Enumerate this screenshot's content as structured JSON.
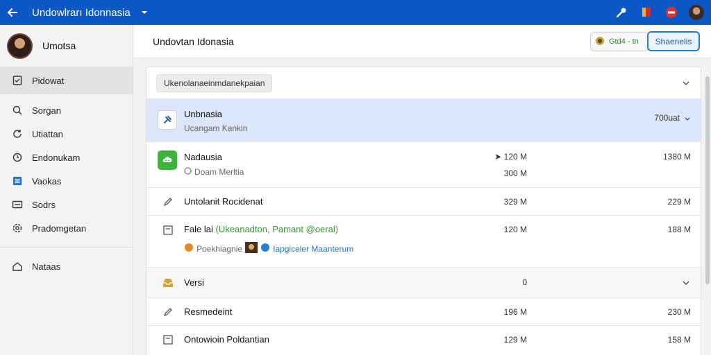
{
  "topbar": {
    "title": "Undowlrarı Idonnasia"
  },
  "sidebar": {
    "user_name": "Umotsa",
    "items": [
      {
        "label": "Pidowat",
        "icon": "document-check-icon"
      },
      {
        "label": "Sorgan",
        "icon": "search-icon"
      },
      {
        "label": "Utiattan",
        "icon": "refresh-icon"
      },
      {
        "label": "Endonukam",
        "icon": "clock-icon"
      },
      {
        "label": "Vaokas",
        "icon": "list-icon"
      },
      {
        "label": "Sodrs",
        "icon": "card-icon"
      },
      {
        "label": "Pradomgetan",
        "icon": "gear-icon"
      },
      {
        "label": "Nataas",
        "icon": "home-icon"
      }
    ]
  },
  "main": {
    "title": "Undovtan Idonasia",
    "pill_text": "Gtd4 - tn",
    "button_label": "Shaenelis"
  },
  "panel": {
    "filter_chip": "Ukenolanaeinmdanekpaian",
    "rows": [
      {
        "title": "Unbnasia",
        "subtitle": "Ucangam Kankin",
        "col2": "700uat"
      },
      {
        "title": "Nadausia",
        "subtitle": "Doam Merltia",
        "col1_top": "120 M",
        "col1_bottom": "300 M",
        "col2": "1380 M"
      },
      {
        "title": "Untolanit Rocidenat",
        "col1": "329 M",
        "col2": "229 M"
      },
      {
        "title_prefix": "Fale lai",
        "title_link": "(Ukeanadton, Pamant @oeral)",
        "sub_a": "Poekhiagnie",
        "sub_b": "Iapgiceler Maanterum",
        "col1": "120 M",
        "col2": "188 M"
      },
      {
        "title": "Versi",
        "col1": "0"
      },
      {
        "title": "Resmedeint",
        "col1": "196 M",
        "col2": "230 M"
      },
      {
        "title": "Ontowioin Poldantian",
        "col1": "129 M",
        "col2": "158 M"
      }
    ]
  },
  "colors": {
    "accent": "#0b57c5",
    "selected_row": "#dbe6fa",
    "positive": "#2e9b2e"
  }
}
